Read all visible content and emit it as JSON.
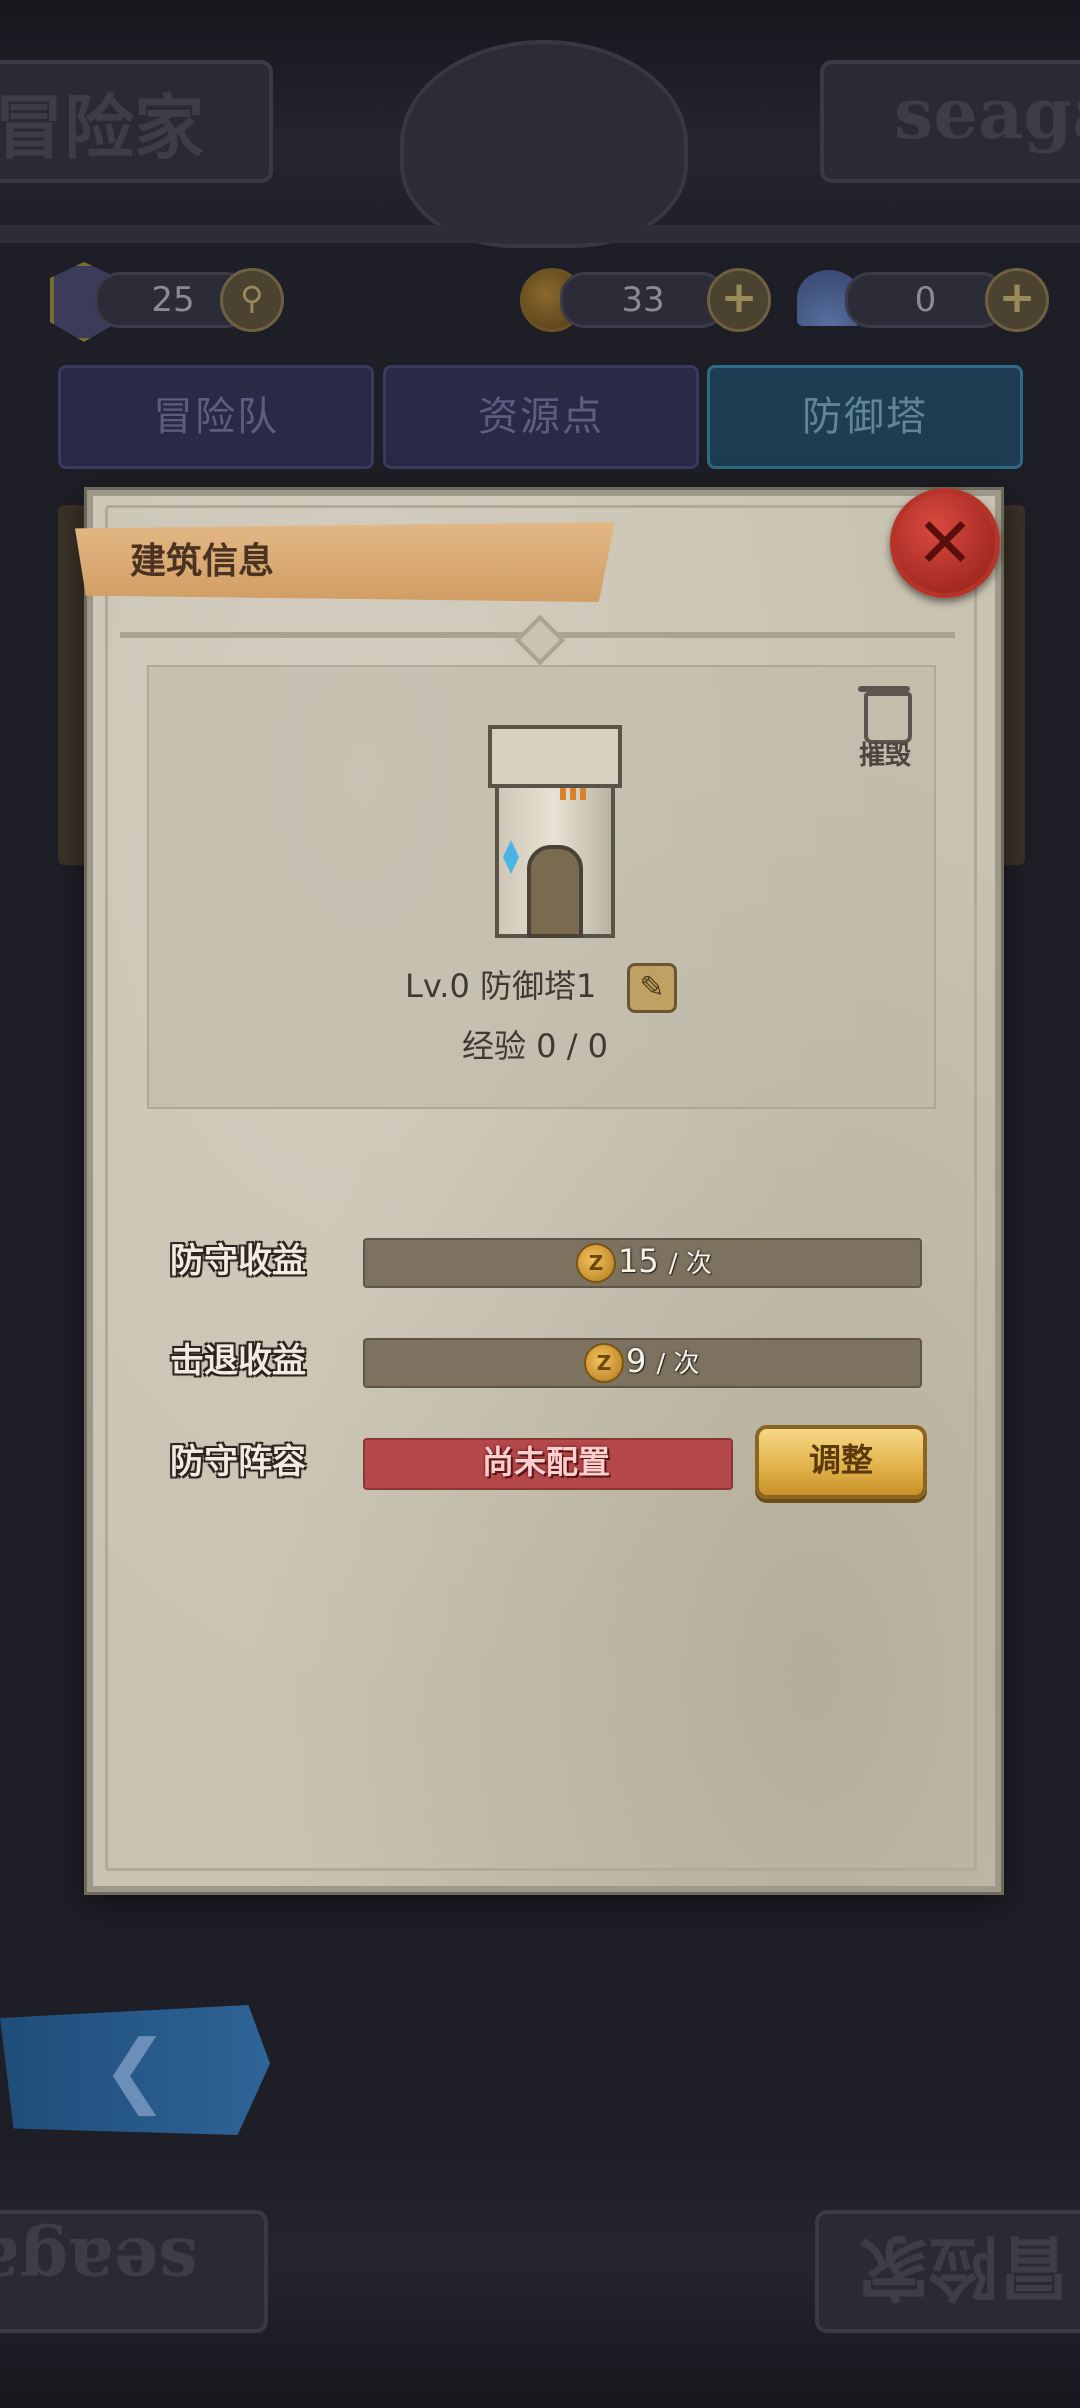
{
  "background": {
    "banner_left_text": "冒险家",
    "banner_right_text": "seaga",
    "bottom_left_text": "seaga",
    "bottom_right_text": "冒险家"
  },
  "currency": {
    "level_value": "25",
    "coin_value": "33",
    "shell_value": "0"
  },
  "tabs": [
    {
      "label": "冒险队",
      "active": false
    },
    {
      "label": "资源点",
      "active": false
    },
    {
      "label": "防御塔",
      "active": true
    }
  ],
  "dialog": {
    "title": "建筑信息",
    "demolish_label": "摧毁",
    "building_name": "Lv.0 防御塔1",
    "experience": "经验 0 / 0",
    "stats": [
      {
        "label": "防守收益",
        "value": "15",
        "unit": "/ 次"
      },
      {
        "label": "击退收益",
        "value": "9",
        "unit": "/ 次"
      }
    ],
    "lineup_label": "防守阵容",
    "lineup_status": "尚未配置",
    "adjust_label": "调整",
    "coin_symbol": "Z"
  },
  "colors": {
    "panel": "#c9c3b2",
    "ribbon": "#d9a86e",
    "close_button": "#b63328",
    "warning": "#b5484a",
    "button_gold": "#e0b148"
  }
}
